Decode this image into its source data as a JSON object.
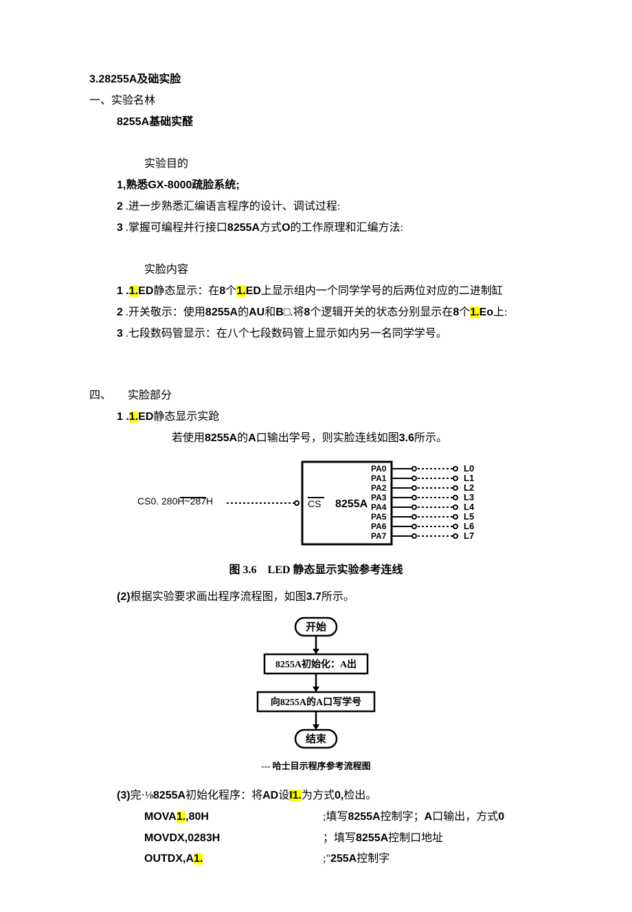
{
  "header": "3.28255A及础实脸",
  "s1_title": "一、实验名林",
  "s1_body": "8255A基础实醛",
  "s2_title": "实验目的",
  "s2_items": {
    "i1": "1,熟悉GX-8000疏脸系统;",
    "i2": "2 .进一步熟悉汇编语言程序的设计、调试过程:",
    "i3": "3 .掌握可编程并行接口8255A方式O的工作原理和汇编方法:"
  },
  "s3_title": "实脸内容",
  "s3_items": {
    "i1_pre": "1 .",
    "i1_hl": "1.",
    "i1_mid1": "ED静态显示：在8个",
    "i1_hl2": "1.",
    "i1_post": "ED上显示组内一个同学学号的后两位对应的二进制缸",
    "i2_pre": "2 .开关敬示：使用8255A的AU和B□.将8个逻辑开关的状态分别显示在8个",
    "i2_hl": "1.",
    "i2_post": "Eo上:",
    "i3": "3 .七段数码管显示：在八个七段数码管上显示如内另一名同学学号。"
  },
  "s4_title": "四、　　实脸部分",
  "s4_1_pre": "1 .",
  "s4_1_hl": "1.",
  "s4_1_post": "ED静态显示实跄",
  "s4_1_desc": "若使用8255A的A口输出学号，则实脸连线如图3.6所示。",
  "diagram1": {
    "cs_label": "CS0. 280H~287H",
    "cs_pin": "CS",
    "chip": "8255A",
    "pa": [
      "PA0",
      "PA1",
      "PA2",
      "PA3",
      "PA4",
      "PA5",
      "PA6",
      "PA7"
    ],
    "l": [
      "L0",
      "L1",
      "L2",
      "L3",
      "L4",
      "L5",
      "L6",
      "L7"
    ],
    "caption": "图 3.6　LED 静态显示实验参考连线"
  },
  "p2": "(2)根据实验要求画出程序流程图，如图3.7所示。",
  "flow": {
    "n1": "开始",
    "n2": "8255A初始化：A出",
    "n3": "向8255A的A口写学号",
    "n4": "结束",
    "caption": "--- 哈士目示程序参考流程图"
  },
  "p3": {
    "pre": "(3)完·⅛8255A初始化程序：将AD设",
    "hl": "I1.",
    "post": "为方式0,检出。"
  },
  "code": {
    "r1_l_pre": "MOVA",
    "r1_l_hl": "1.",
    "r1_l_post": ",80H",
    "r1_r": ";填写8255A控制字；A口输出，方式0",
    "r2_l": "MOVDX,0283H",
    "r2_r": "；填写8255A控制口地址",
    "r3_l_pre": "OUTDX,A",
    "r3_l_hl": "1.",
    "r3_r": ";\"255A控制字"
  }
}
